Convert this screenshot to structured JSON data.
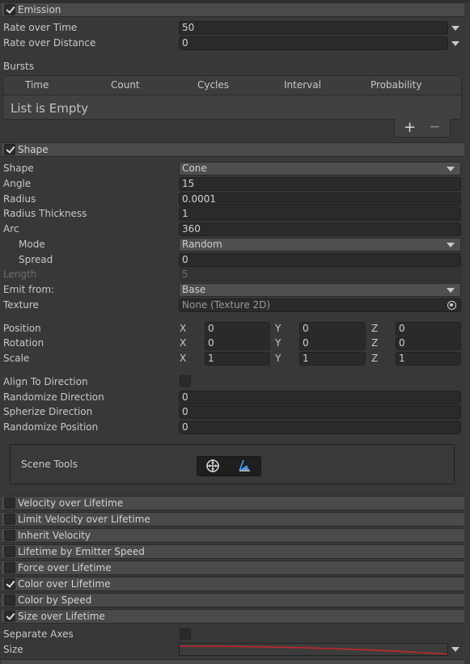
{
  "emission": {
    "title": "Emission",
    "checked": true,
    "rate_over_time_label": "Rate over Time",
    "rate_over_time_value": "50",
    "rate_over_distance_label": "Rate over Distance",
    "rate_over_distance_value": "0",
    "bursts_label": "Bursts",
    "bursts_columns": [
      "Time",
      "Count",
      "Cycles",
      "Interval",
      "Probability"
    ],
    "bursts_empty": "List is Empty",
    "add_symbol": "+",
    "remove_symbol": "−"
  },
  "shape": {
    "title": "Shape",
    "checked": true,
    "shape_label": "Shape",
    "shape_value": "Cone",
    "angle_label": "Angle",
    "angle_value": "15",
    "radius_label": "Radius",
    "radius_value": "0.0001",
    "radius_thickness_label": "Radius Thickness",
    "radius_thickness_value": "1",
    "arc_label": "Arc",
    "arc_value": "360",
    "mode_label": "Mode",
    "mode_value": "Random",
    "spread_label": "Spread",
    "spread_value": "0",
    "length_label": "Length",
    "length_value": "5",
    "emit_from_label": "Emit from:",
    "emit_from_value": "Base",
    "texture_label": "Texture",
    "texture_value": "None (Texture 2D)",
    "position_label": "Position",
    "rotation_label": "Rotation",
    "scale_label": "Scale",
    "axis_x": "X",
    "axis_y": "Y",
    "axis_z": "Z",
    "position": {
      "x": "0",
      "y": "0",
      "z": "0"
    },
    "rotation": {
      "x": "0",
      "y": "0",
      "z": "0"
    },
    "scale": {
      "x": "1",
      "y": "1",
      "z": "1"
    },
    "align_to_direction_label": "Align To Direction",
    "align_to_direction_checked": false,
    "randomize_direction_label": "Randomize Direction",
    "randomize_direction_value": "0",
    "spherize_direction_label": "Spherize Direction",
    "spherize_direction_value": "0",
    "randomize_position_label": "Randomize Position",
    "randomize_position_value": "0",
    "scene_tools_label": "Scene Tools"
  },
  "modules": [
    {
      "title": "Velocity over Lifetime",
      "checked": false
    },
    {
      "title": "Limit Velocity over Lifetime",
      "checked": false
    },
    {
      "title": "Inherit Velocity",
      "checked": false
    },
    {
      "title": "Lifetime by Emitter Speed",
      "checked": false
    },
    {
      "title": "Force over Lifetime",
      "checked": false
    },
    {
      "title": "Color over Lifetime",
      "checked": true
    },
    {
      "title": "Color by Speed",
      "checked": false
    },
    {
      "title": "Size over Lifetime",
      "checked": true
    }
  ],
  "size_over_lifetime": {
    "separate_axes_label": "Separate Axes",
    "separate_axes_checked": false,
    "size_label": "Size",
    "curve_color": "#c0282a"
  },
  "colors": {
    "background": "#383838",
    "header": "#4a4a4a",
    "field": "#2a2a2a",
    "accent_blue": "#4aa3ff"
  }
}
